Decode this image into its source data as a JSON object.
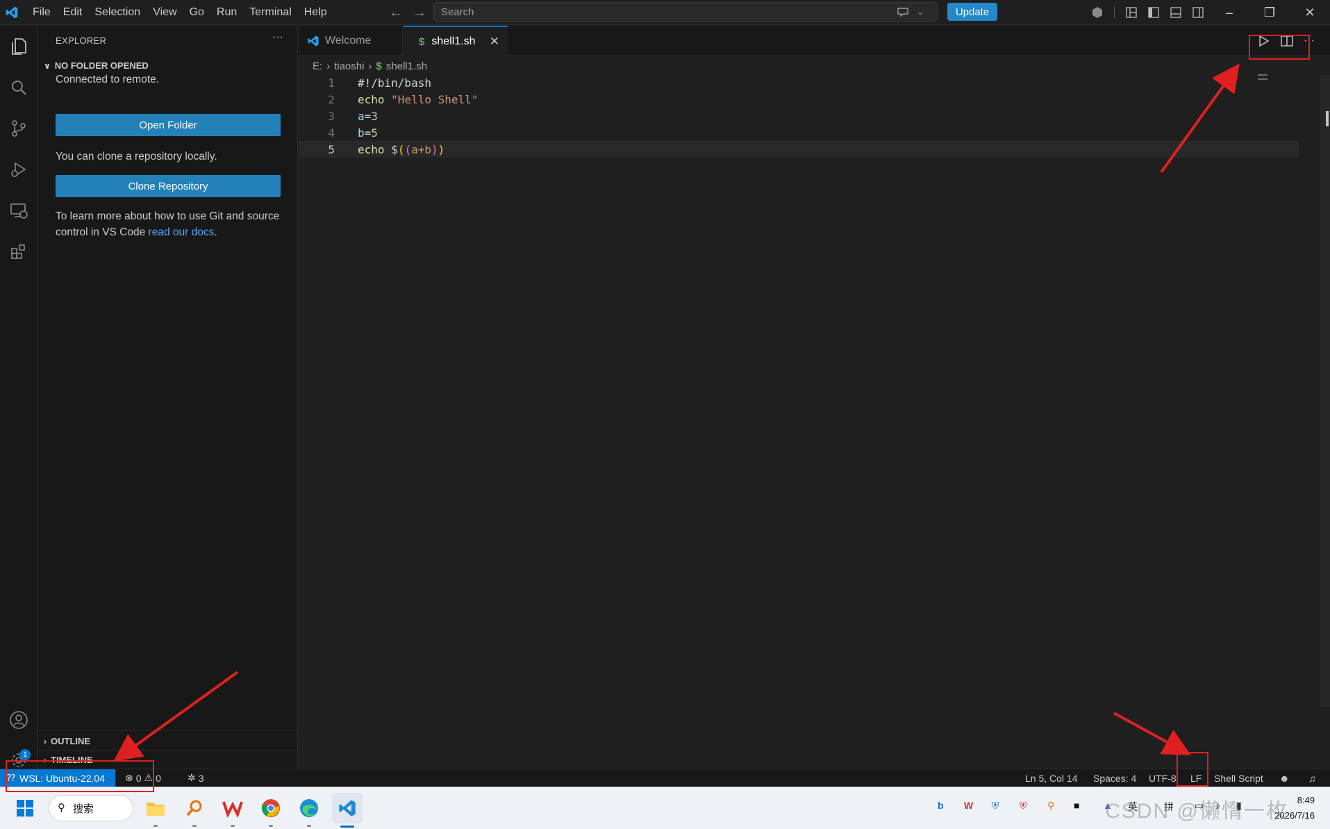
{
  "menu": [
    "File",
    "Edit",
    "Selection",
    "View",
    "Go",
    "Run",
    "Terminal",
    "Help"
  ],
  "search": {
    "placeholder": "Search"
  },
  "update_label": "Update",
  "sidebar": {
    "header": "EXPLORER",
    "more": "···",
    "no_folder_title": "NO FOLDER OPENED",
    "connected_text": "Connected to remote.",
    "open_folder_label": "Open Folder",
    "clone_text": "You can clone a repository locally.",
    "clone_label": "Clone Repository",
    "learn_text": "To learn more about how to use Git and source control in VS Code ",
    "learn_link": "read our docs",
    "learn_end": ".",
    "outline_title": "OUTLINE",
    "timeline_title": "TIMELINE"
  },
  "tabs": [
    {
      "label": "Welcome",
      "active": false
    },
    {
      "label": "shell1.sh",
      "active": true
    }
  ],
  "breadcrumb": [
    "E:",
    "tiaoshi",
    "shell1.sh"
  ],
  "code": {
    "lines": [
      {
        "no": "1",
        "text": "#!/bin/bash"
      },
      {
        "no": "2",
        "text": "echo \"Hello Shell\""
      },
      {
        "no": "3",
        "text": "a=3"
      },
      {
        "no": "4",
        "text": "b=5"
      },
      {
        "no": "5",
        "text": "echo $((a+b))"
      }
    ]
  },
  "status": {
    "remote": "WSL: Ubuntu-22.04",
    "errors": "0",
    "warnings": "0",
    "ports": "3",
    "position": "Ln 5, Col 14",
    "spaces": "Spaces: 4",
    "encoding": "UTF-8",
    "eol": "LF",
    "language": "Shell Script"
  },
  "taskbar": {
    "search_label": "搜索",
    "tray_lang": "英",
    "tray_ime": "拼",
    "time": "8:49",
    "date": "2026/7/16"
  },
  "watermark": "CSDN @懒惰一枚",
  "colors": {
    "accent": "#0078d4",
    "button": "#2480b8",
    "annotation": "#e02020"
  }
}
